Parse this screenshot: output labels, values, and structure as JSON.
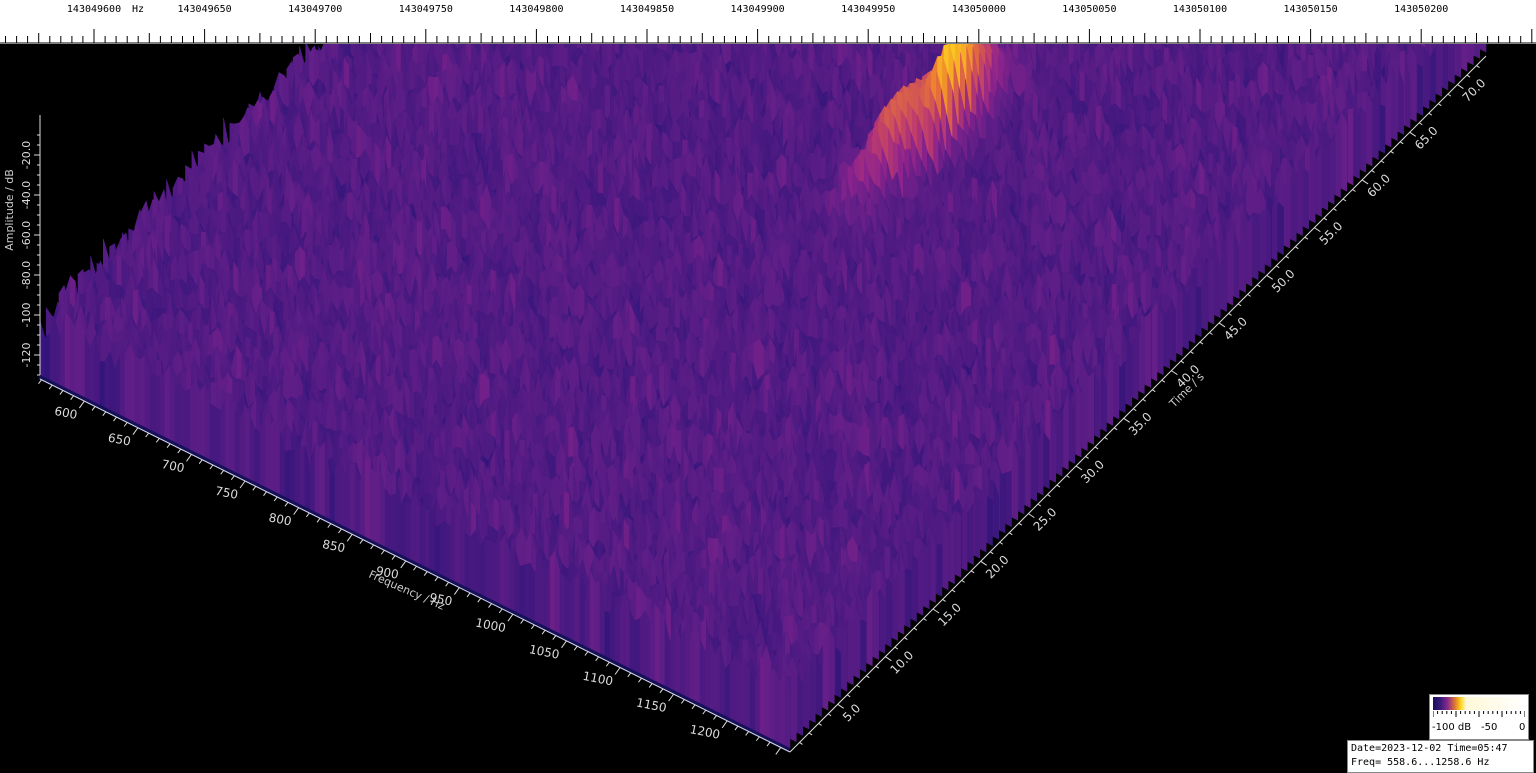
{
  "chart_data": {
    "type": "waterfall-3d",
    "top_axis": {
      "unit": "Hz",
      "labels": [
        "143049600",
        "143049650",
        "143049700",
        "143049750",
        "143049800",
        "143049850",
        "143049900",
        "143049950",
        "143050000",
        "143050050",
        "143050100",
        "143050150",
        "143050200"
      ]
    },
    "frequency_axis": {
      "label": "Frequency / Hz",
      "ticks": [
        "600",
        "650",
        "700",
        "750",
        "800",
        "850",
        "900",
        "950",
        "1000",
        "1050",
        "1100",
        "1150",
        "1200"
      ],
      "range": [
        558.6,
        1258.6
      ]
    },
    "time_axis": {
      "label": "Time / s",
      "ticks": [
        "5.0",
        "10.0",
        "15.0",
        "20.0",
        "25.0",
        "30.0",
        "35.0",
        "40.0",
        "45.0",
        "50.0",
        "55.0",
        "60.0",
        "65.0",
        "70.0"
      ],
      "range": [
        0,
        73
      ]
    },
    "amplitude_axis": {
      "label": "Amplitude / dB",
      "ticks": [
        "-20.0",
        "-40.0",
        "-60.0",
        "-80.0",
        "-100",
        "-120"
      ],
      "range": [
        -130,
        0
      ]
    },
    "peaks": [
      {
        "freq_hz": 1010,
        "time_s": 45,
        "amplitude_db": -55
      },
      {
        "freq_hz": 995,
        "time_s": 41,
        "amplitude_db": -68
      }
    ],
    "colors": {
      "low": "#1a0a6b",
      "mid": "#6a1e8a",
      "high": "#ffd21a"
    }
  },
  "legend": {
    "labels": [
      "-100 dB",
      "-50",
      "0"
    ]
  },
  "info": {
    "date_line": "Date=2023-12-02 Time=05:47",
    "freq_line": "Freq= 558.6...1258.6 Hz"
  }
}
